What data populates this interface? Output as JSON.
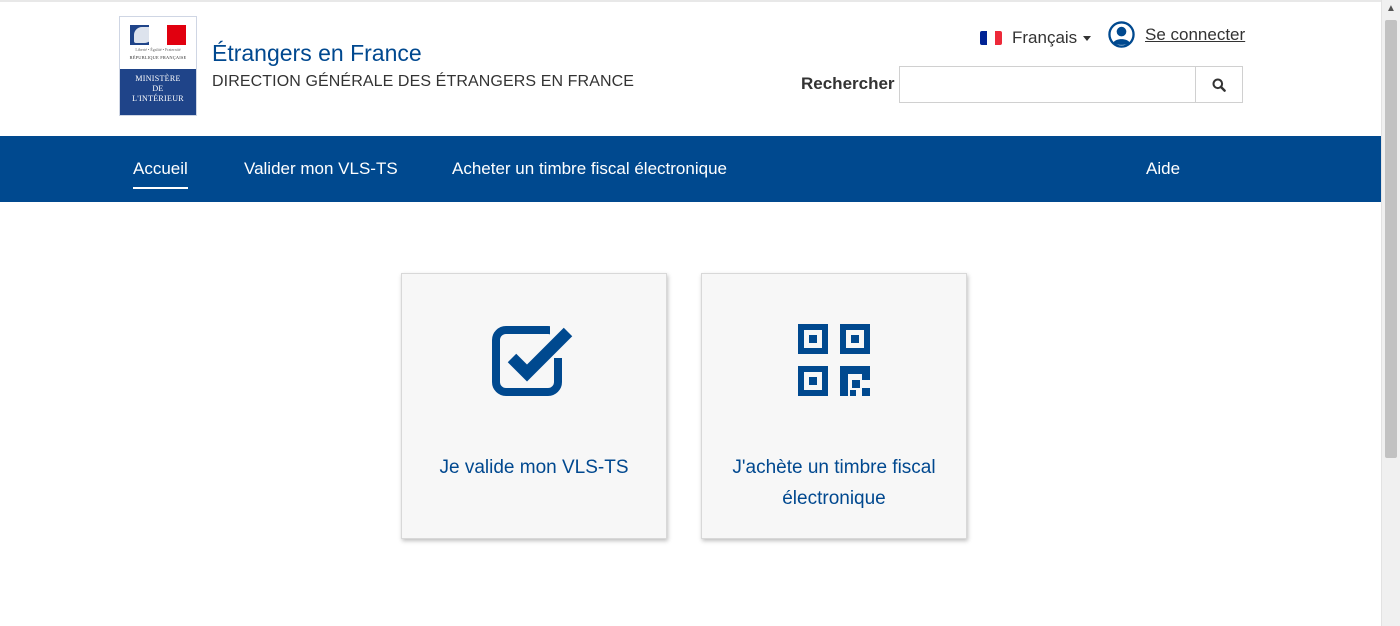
{
  "header": {
    "logo": {
      "motto": "Liberté • Égalité • Fraternité",
      "republic": "RÉPUBLIQUE FRANÇAISE",
      "ministry_line1": "MINISTÈRE",
      "ministry_line2": "DE",
      "ministry_line3": "L'INTÉRIEUR"
    },
    "site_title": "Étrangers en France",
    "site_subtitle": "DIRECTION GÉNÉRALE DES ÉTRANGERS EN FRANCE",
    "language": "Français",
    "login": "Se connecter",
    "search": {
      "label": "Rechercher",
      "value": "",
      "placeholder": ""
    }
  },
  "nav": {
    "items": [
      {
        "label": "Accueil",
        "active": true
      },
      {
        "label": "Valider mon VLS-TS",
        "active": false
      },
      {
        "label": "Acheter un timbre fiscal électronique",
        "active": false
      },
      {
        "label": "Aide",
        "active": false
      }
    ]
  },
  "cards": [
    {
      "label": "Je valide mon VLS-TS",
      "icon": "checkbox-checked-icon"
    },
    {
      "label_line1": "J'achète un timbre fiscal",
      "label_line2": "électronique",
      "icon": "qrcode-icon"
    }
  ],
  "colors": {
    "brand_blue": "#00498f",
    "flag_blue": "#002395",
    "flag_white": "#ffffff",
    "flag_red": "#ed2939"
  }
}
